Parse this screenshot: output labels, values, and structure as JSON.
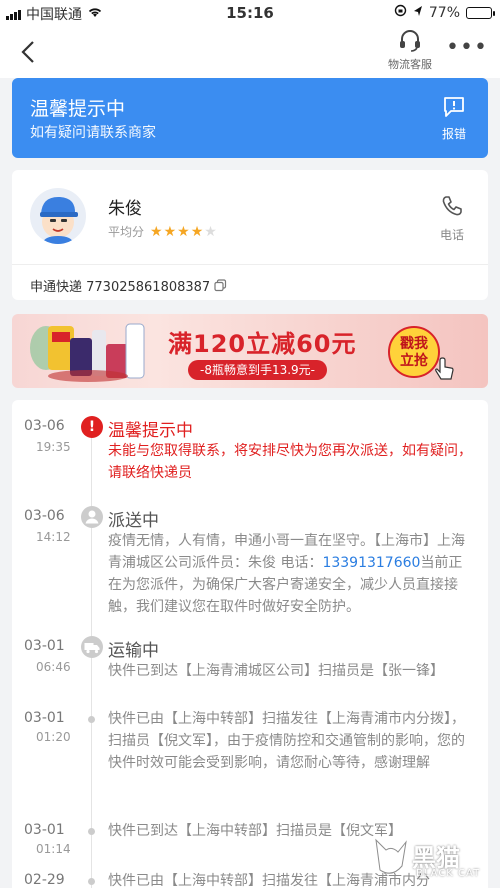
{
  "status_bar": {
    "carrier": "中国联通",
    "time": "15:16",
    "battery": "77%",
    "battery_level": 0.77
  },
  "nav": {
    "service_label": "物流客服",
    "more_label": "•••"
  },
  "notice": {
    "title": "温馨提示中",
    "subtitle": "如有疑问请联系商家",
    "report_label": "报错"
  },
  "courier": {
    "name": "朱俊",
    "rating_label": "平均分",
    "rating_stars": 4,
    "rating_max": 5,
    "call_label": "电话",
    "tracking": "申通快递 773025861808387"
  },
  "ad": {
    "headline": "满120立减60元",
    "sub": "-8瓶畅意到手13.9元-",
    "cta_line1": "戳我",
    "cta_line2": "立抢"
  },
  "timeline": [
    {
      "date": "03-06",
      "time": "19:35",
      "title": "温馨提示中",
      "body": "未能与您取得联系，将安排尽快为您再次派送，如有疑问，请联络快递员"
    },
    {
      "date": "03-06",
      "time": "14:12",
      "title": "派送中",
      "body_pre": "疫情无情，人有情，申通小哥一直在坚守。【上海市】上海青浦城区公司派件员：朱俊 电话：",
      "phone": "13391317660",
      "body_post": "当前正在为您派件，为确保广大客户寄递安全，减少人员直接接触，我们建议您在取件时做好安全防护。"
    },
    {
      "date": "03-01",
      "time": "06:46",
      "title": "运输中",
      "body": "快件已到达【上海青浦城区公司】扫描员是【张一锋】"
    },
    {
      "date": "03-01",
      "time": "01:20",
      "body": "快件已由【上海中转部】扫描发往【上海青浦市内分拨】，扫描员【倪文军】，由于疫情防控和交通管制的影响，您的快件时效可能会受到影响，请您耐心等待，感谢理解"
    },
    {
      "date": "03-01",
      "time": "01:14",
      "body": "快件已到达【上海中转部】扫描员是【倪文军】"
    },
    {
      "date": "02-29",
      "body": "快件已由【上海中转部】扫描发往【上海青浦市内分"
    }
  ],
  "watermark": {
    "text": "黑猫",
    "sub": "BLACK CAT"
  }
}
